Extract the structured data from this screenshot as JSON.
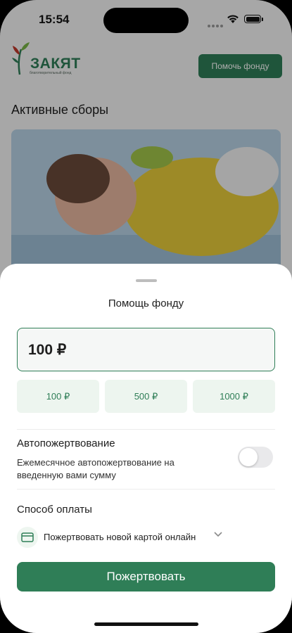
{
  "status_bar": {
    "time": "15:54"
  },
  "header": {
    "logo_name": "ЗАКЯТ",
    "logo_subtitle": "благотворительный фонд",
    "help_button_label": "Помочь фонду"
  },
  "main": {
    "section_title": "Активные сборы"
  },
  "sheet": {
    "title": "Помощь фонду",
    "amount_value": "100 ₽",
    "preset_amounts": [
      "100 ₽",
      "500 ₽",
      "1000 ₽"
    ],
    "auto_donation": {
      "title": "Автопожертвование",
      "description": "Ежемесячное автопожертвование на введенную вами сумму",
      "enabled": false
    },
    "payment": {
      "title": "Способ оплаты",
      "method_label": "Пожертвовать новой картой онлайн"
    },
    "donate_button_label": "Пожертвовать"
  },
  "colors": {
    "accent": "#2f7e57",
    "chip_bg": "#edf5ef"
  }
}
